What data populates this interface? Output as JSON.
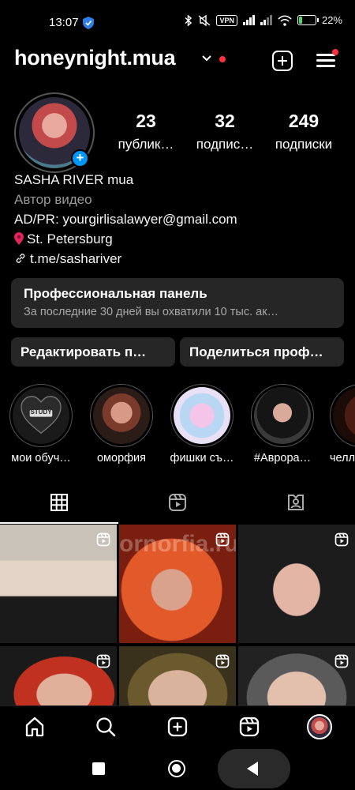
{
  "status_bar": {
    "time": "13:07",
    "vpn": "VPN",
    "battery_percent": "22%",
    "battery_level": 0.22,
    "icons": [
      "shield-icon",
      "bluetooth-icon",
      "mute-icon",
      "vpn-icon",
      "signal-icon",
      "signal-icon",
      "wifi-icon",
      "battery-icon"
    ]
  },
  "header": {
    "username": "honeynight.mua",
    "icons": [
      "chevron-down-icon",
      "add-post-icon",
      "menu-icon"
    ]
  },
  "profile": {
    "stats": [
      {
        "value": "23",
        "label": "публик…"
      },
      {
        "value": "32",
        "label": "подпис…"
      },
      {
        "value": "249",
        "label": "подписки"
      }
    ],
    "name": "SASHA RIVER mua",
    "category": "Автор видео",
    "contact": "AD/PR: yourgirlisalawyer@gmail.com",
    "location": "St. Petersburg",
    "link": "t.me/sashariver"
  },
  "professional_panel": {
    "title": "Профессиональная панель",
    "subtitle": "За последние 30 дней вы охватили 10 тыс. ак…"
  },
  "buttons": {
    "edit": "Редактировать п…",
    "share": "Поделиться проф…"
  },
  "highlights": [
    {
      "label": "мои обуч…",
      "cover_text": "STUDY"
    },
    {
      "label": "оморфия",
      "cover_text": ""
    },
    {
      "label": "фишки съ…",
      "cover_text": ""
    },
    {
      "label": "#Аврора…",
      "cover_text": ""
    },
    {
      "label": "челл",
      "cover_text": ""
    }
  ],
  "tabs": [
    {
      "name": "grid",
      "icon": "grid-icon",
      "active": true
    },
    {
      "name": "reels",
      "icon": "reels-icon",
      "active": false
    },
    {
      "name": "tagged",
      "icon": "tagged-icon",
      "active": false
    }
  ],
  "watermark": "ornorfia.ru",
  "bottom_nav": [
    "home-icon",
    "search-icon",
    "create-icon",
    "reels-icon",
    "profile-avatar"
  ],
  "system_nav": [
    "recents-button",
    "home-button",
    "back-button"
  ],
  "colors": {
    "background": "#000000",
    "surface": "#262626",
    "accent_blue": "#0095f6",
    "notification_red": "#ff3040",
    "secondary_text": "#a8a8a8"
  }
}
